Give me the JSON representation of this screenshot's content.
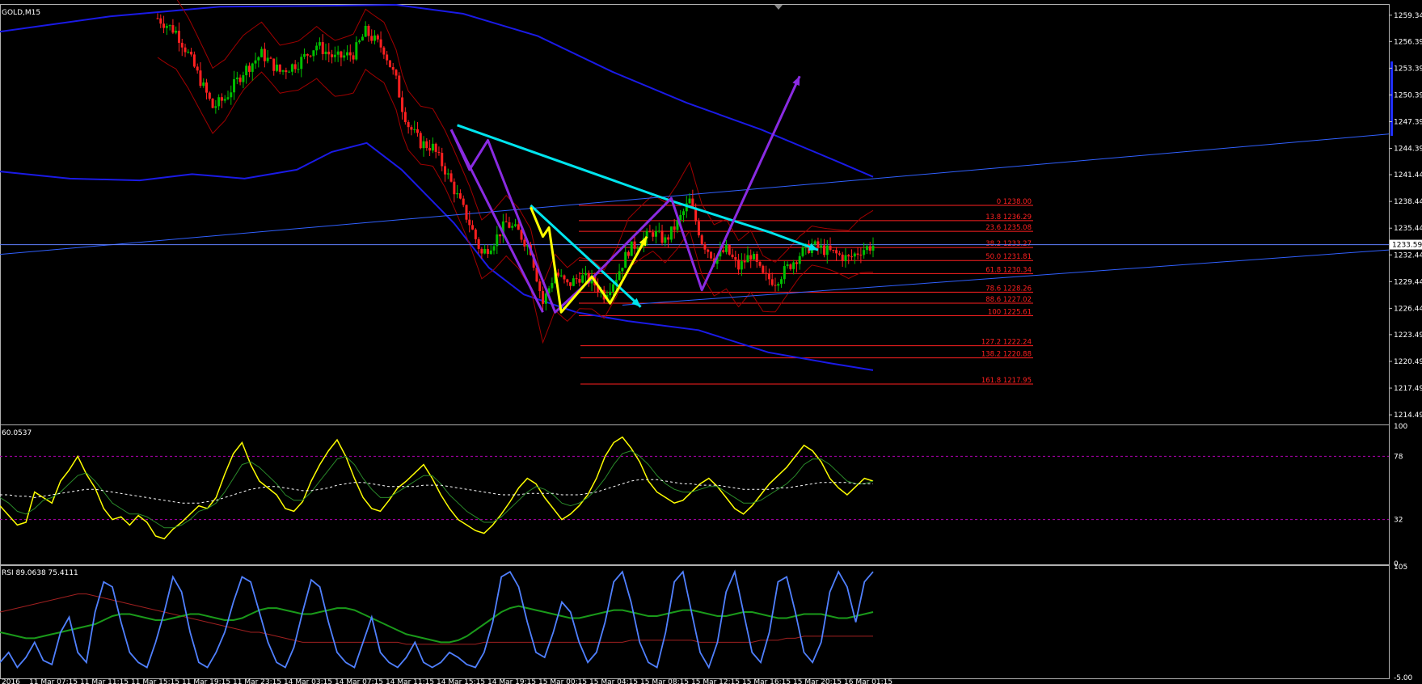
{
  "window": {
    "symbol": "GOLD,M15"
  },
  "colors": {
    "background": "#000000",
    "grid_axis": "#c0c0c0",
    "bull": "#00c000",
    "bear": "#ff2020",
    "ma_blue": "#1a1ae6",
    "bollinger": "#a00000",
    "fib": "#ff2020",
    "cyan": "#00e5ee",
    "purple": "#8a2be2",
    "yellow": "#ffff00",
    "rsi_blue": "#5080ff",
    "dash_magenta": "#b000b0"
  },
  "chart_data": [
    {
      "panel": "main",
      "type": "candlestick",
      "title": "GOLD,M15",
      "ylim": [
        1213.5,
        1260.5
      ],
      "y_ticks": [
        "1259.34",
        "1256.39",
        "1253.39",
        "1250.39",
        "1247.39",
        "1244.39",
        "1241.44",
        "1238.44",
        "1235.44",
        "1232.44",
        "1229.44",
        "1226.44",
        "1223.49",
        "1220.49",
        "1217.49",
        "1214.49"
      ],
      "y_tick_values": [
        1259.34,
        1256.39,
        1253.39,
        1250.39,
        1247.39,
        1244.39,
        1241.44,
        1238.44,
        1235.44,
        1232.44,
        1229.44,
        1226.44,
        1223.49,
        1220.49,
        1217.49,
        1214.49
      ],
      "current_price": "1233.59",
      "close_path": [
        [
          0,
          1259.0
        ],
        [
          3,
          1257.5
        ],
        [
          5,
          1255.0
        ],
        [
          7,
          1252.0
        ],
        [
          9,
          1249.0
        ],
        [
          11,
          1250.0
        ],
        [
          14,
          1253.0
        ],
        [
          17,
          1255.0
        ],
        [
          20,
          1253.0
        ],
        [
          23,
          1254.0
        ],
        [
          26,
          1256.0
        ],
        [
          29,
          1254.5
        ],
        [
          32,
          1255.0
        ],
        [
          34,
          1257.5
        ],
        [
          37,
          1255.5
        ],
        [
          39,
          1252.0
        ],
        [
          40,
          1249.0
        ],
        [
          41,
          1247.0
        ],
        [
          43,
          1245.0
        ],
        [
          45,
          1244.5
        ],
        [
          47,
          1242.0
        ],
        [
          49,
          1239.0
        ],
        [
          51,
          1236.0
        ],
        [
          53,
          1232.5
        ],
        [
          55,
          1234.0
        ],
        [
          57,
          1236.0
        ],
        [
          59,
          1235.0
        ],
        [
          61,
          1233.0
        ],
        [
          63,
          1227.0
        ],
        [
          65,
          1230.5
        ],
        [
          67,
          1229.0
        ],
        [
          69,
          1230.0
        ],
        [
          71,
          1229.5
        ],
        [
          73,
          1228.0
        ],
        [
          75,
          1230.0
        ],
        [
          77,
          1233.0
        ],
        [
          79,
          1234.0
        ],
        [
          81,
          1235.0
        ],
        [
          83,
          1234.0
        ],
        [
          85,
          1236.0
        ],
        [
          87,
          1238.5
        ],
        [
          89,
          1234.0
        ],
        [
          91,
          1232.0
        ],
        [
          93,
          1233.0
        ],
        [
          95,
          1231.0
        ],
        [
          97,
          1232.5
        ],
        [
          99,
          1230.0
        ],
        [
          101,
          1229.5
        ],
        [
          103,
          1231.0
        ],
        [
          105,
          1232.5
        ],
        [
          107,
          1233.5
        ],
        [
          109,
          1233.0
        ],
        [
          111,
          1232.5
        ],
        [
          113,
          1232.0
        ],
        [
          115,
          1233.0
        ],
        [
          117,
          1233.5
        ]
      ],
      "fibonacci": [
        {
          "label": "0 1238.00",
          "price": 1238.0
        },
        {
          "label": "13.8 1236.29",
          "price": 1236.29
        },
        {
          "label": "23.6 1235.08",
          "price": 1235.08
        },
        {
          "label": "38.2 1233.27",
          "price": 1233.27
        },
        {
          "label": "50.0 1231.81",
          "price": 1231.81
        },
        {
          "label": "61.8 1230.34",
          "price": 1230.34
        },
        {
          "label": "78.6 1228.26",
          "price": 1228.26
        },
        {
          "label": "88.6 1227.02",
          "price": 1227.02
        },
        {
          "label": "100 1225.61",
          "price": 1225.61
        },
        {
          "label": "127.2 1222.24",
          "price": 1222.24
        },
        {
          "label": "138.2 1220.88",
          "price": 1220.88
        },
        {
          "label": "161.8 1217.95",
          "price": 1217.95
        }
      ],
      "ma_upper": [
        [
          0,
          1257.5
        ],
        [
          10,
          1259.2
        ],
        [
          20,
          1260.3
        ],
        [
          30,
          1260.4
        ],
        [
          36,
          1260.5
        ],
        [
          45,
          1259.5
        ],
        [
          55,
          1257.0
        ],
        [
          65,
          1253.0
        ],
        [
          75,
          1249.5
        ],
        [
          85,
          1246.5
        ],
        [
          95,
          1243.0
        ],
        [
          100,
          1241.2
        ]
      ],
      "ma_lower": [
        [
          0,
          1241.8
        ],
        [
          8,
          1241.0
        ],
        [
          16,
          1240.8
        ],
        [
          22,
          1241.5
        ],
        [
          28,
          1241.0
        ],
        [
          34,
          1242.0
        ],
        [
          38,
          1244.0
        ],
        [
          42,
          1245.0
        ],
        [
          46,
          1242.0
        ],
        [
          52,
          1236.0
        ],
        [
          56,
          1231.0
        ],
        [
          60,
          1228.0
        ],
        [
          66,
          1226.0
        ],
        [
          72,
          1225.0
        ],
        [
          80,
          1224.0
        ],
        [
          88,
          1221.5
        ],
        [
          95,
          1220.3
        ],
        [
          100,
          1219.5
        ]
      ],
      "drawings": {
        "cyan_trend": [
          [
            49,
            1247.0
          ],
          [
            84,
            1238.5
          ],
          [
            100,
            1235.0
          ],
          [
            108,
            1233.0
          ]
        ],
        "cyan_small": [
          [
            61,
            1238.0
          ],
          [
            79,
            1226.6
          ]
        ],
        "purple_zigzag": [
          [
            48,
            1246.5
          ],
          [
            51,
            1242.0
          ],
          [
            54,
            1245.3
          ],
          [
            65,
            1226.0
          ],
          [
            71,
            1229.8
          ],
          [
            84,
            1238.8
          ],
          [
            89,
            1228.5
          ],
          [
            105,
            1252.5
          ]
        ],
        "purple_early": [
          [
            48,
            1246.5
          ],
          [
            63,
            1226.0
          ]
        ],
        "yellow_zigzag": [
          [
            61,
            1237.8
          ],
          [
            63,
            1234.5
          ],
          [
            64,
            1235.5
          ],
          [
            66,
            1226.0
          ],
          [
            71,
            1230.0
          ],
          [
            74,
            1227.0
          ],
          [
            80,
            1234.5
          ]
        ],
        "blue_channel_upper": [
          [
            0,
            1232.5
          ],
          [
            117,
            1246.0
          ]
        ],
        "blue_channel_lower": [
          [
            76,
            1226.8
          ],
          [
            117,
            1233.0
          ]
        ],
        "h_line": 1233.59
      }
    },
    {
      "panel": "oscillator",
      "type": "line",
      "label": "60.0537",
      "y_ticks": [
        "100",
        "78",
        "32",
        "0"
      ],
      "y_tick_values": [
        100,
        78,
        32,
        0
      ],
      "ylim": [
        0,
        100
      ],
      "levels": [
        78,
        32
      ],
      "series": [
        {
          "values": [
            42,
            35,
            28,
            30,
            52,
            48,
            44,
            60,
            68,
            78,
            65,
            55,
            40,
            32,
            34,
            28,
            35,
            30,
            20,
            18,
            25,
            30,
            36,
            42,
            40,
            48,
            65,
            80,
            88,
            72,
            60,
            55,
            50,
            40,
            38,
            45,
            60,
            72,
            82,
            90,
            78,
            62,
            48,
            40,
            38,
            46,
            55,
            60,
            66,
            72,
            62,
            50,
            40,
            32,
            28,
            24,
            22,
            28,
            36,
            45,
            55,
            62,
            58,
            48,
            40,
            32,
            36,
            42,
            50,
            62,
            78,
            88,
            92,
            84,
            74,
            60,
            52,
            48,
            44,
            46,
            52,
            58,
            62,
            56,
            48,
            40,
            36,
            42,
            50,
            58,
            64,
            70,
            78,
            86,
            82,
            74,
            62,
            55,
            50,
            56,
            62,
            60
          ]
        },
        {
          "values": [
            48,
            44,
            38,
            36,
            40,
            46,
            48,
            52,
            58,
            64,
            66,
            60,
            52,
            44,
            40,
            36,
            36,
            34,
            30,
            26,
            26,
            28,
            32,
            38,
            40,
            44,
            52,
            62,
            72,
            74,
            70,
            64,
            58,
            50,
            46,
            46,
            52,
            60,
            68,
            76,
            78,
            72,
            62,
            54,
            48,
            48,
            52,
            56,
            60,
            64,
            64,
            58,
            50,
            44,
            38,
            34,
            30,
            30,
            34,
            40,
            46,
            52,
            56,
            54,
            50,
            44,
            42,
            44,
            48,
            54,
            62,
            72,
            80,
            82,
            78,
            72,
            64,
            58,
            54,
            52,
            52,
            54,
            56,
            56,
            52,
            48,
            44,
            44,
            46,
            50,
            54,
            58,
            64,
            72,
            76,
            76,
            72,
            66,
            60,
            58,
            58,
            60
          ]
        },
        {
          "values": [
            50,
            50,
            49,
            49,
            48,
            49,
            50,
            51,
            52,
            53,
            54,
            54,
            53,
            52,
            51,
            50,
            49,
            48,
            47,
            46,
            45,
            44,
            44,
            44,
            45,
            46,
            48,
            50,
            52,
            54,
            55,
            56,
            56,
            55,
            54,
            53,
            53,
            54,
            55,
            57,
            58,
            59,
            59,
            58,
            57,
            56,
            56,
            56,
            56,
            57,
            57,
            57,
            56,
            55,
            54,
            53,
            52,
            51,
            50,
            50,
            50,
            51,
            51,
            51,
            51,
            50,
            50,
            50,
            51,
            52,
            54,
            56,
            58,
            60,
            61,
            61,
            61,
            60,
            59,
            58,
            58,
            57,
            57,
            57,
            56,
            55,
            54,
            54,
            54,
            54,
            55,
            55,
            56,
            57,
            58,
            59,
            59,
            59,
            59,
            58,
            58,
            58
          ]
        }
      ]
    },
    {
      "panel": "rsi",
      "type": "line",
      "label": "RSI 89.0638 75.4111",
      "y_ticks": [
        "105",
        "-5.00"
      ],
      "y_tick_values": [
        105,
        -5
      ],
      "ylim": [
        -5,
        105
      ],
      "series": [
        {
          "values": [
            10,
            20,
            5,
            15,
            30,
            12,
            8,
            40,
            55,
            20,
            10,
            60,
            90,
            85,
            50,
            20,
            10,
            5,
            30,
            60,
            95,
            80,
            40,
            10,
            5,
            20,
            40,
            70,
            95,
            90,
            60,
            30,
            10,
            5,
            25,
            60,
            92,
            85,
            50,
            20,
            10,
            5,
            30,
            55,
            20,
            10,
            5,
            15,
            30,
            10,
            5,
            10,
            20,
            15,
            8,
            5,
            20,
            50,
            95,
            100,
            85,
            50,
            20,
            15,
            40,
            70,
            60,
            30,
            10,
            20,
            50,
            90,
            100,
            70,
            30,
            10,
            5,
            40,
            90,
            100,
            60,
            20,
            5,
            30,
            80,
            100,
            60,
            20,
            10,
            40,
            90,
            95,
            60,
            20,
            10,
            30,
            80,
            100,
            85,
            50,
            90,
            100
          ]
        },
        {
          "values": [
            40,
            38,
            36,
            34,
            34,
            36,
            38,
            40,
            42,
            44,
            46,
            48,
            52,
            56,
            58,
            58,
            56,
            54,
            52,
            52,
            54,
            56,
            58,
            58,
            56,
            54,
            52,
            52,
            54,
            58,
            62,
            64,
            64,
            62,
            60,
            58,
            58,
            60,
            62,
            64,
            64,
            62,
            58,
            54,
            50,
            46,
            42,
            38,
            36,
            34,
            32,
            30,
            30,
            32,
            36,
            42,
            48,
            54,
            60,
            64,
            66,
            64,
            62,
            60,
            58,
            56,
            54,
            54,
            56,
            58,
            60,
            62,
            62,
            60,
            58,
            56,
            56,
            58,
            60,
            62,
            62,
            60,
            58,
            56,
            56,
            58,
            60,
            60,
            58,
            56,
            54,
            54,
            56,
            58,
            58,
            58,
            56,
            54,
            54,
            56,
            58,
            60
          ]
        },
        {
          "values": [
            60,
            62,
            64,
            66,
            68,
            70,
            72,
            74,
            76,
            78,
            78,
            76,
            74,
            72,
            70,
            68,
            66,
            64,
            62,
            60,
            58,
            56,
            54,
            52,
            50,
            48,
            46,
            44,
            42,
            40,
            40,
            38,
            36,
            34,
            32,
            30,
            30,
            30,
            30,
            30,
            30,
            30,
            30,
            30,
            30,
            30,
            30,
            28,
            28,
            28,
            28,
            28,
            28,
            28,
            28,
            28,
            30,
            30,
            30,
            30,
            30,
            30,
            30,
            30,
            30,
            30,
            30,
            30,
            30,
            30,
            30,
            30,
            30,
            32,
            32,
            32,
            32,
            32,
            32,
            32,
            32,
            30,
            30,
            30,
            30,
            30,
            30,
            30,
            32,
            32,
            32,
            34,
            34,
            36,
            36,
            36,
            36,
            36,
            36,
            36,
            36,
            36
          ]
        }
      ]
    }
  ],
  "x_axis_labels": [
    "2016",
    "11 Mar 07:15",
    "11 Mar 11:15",
    "11 Mar 15:15",
    "11 Mar 19:15",
    "11 Mar 23:15",
    "14 Mar 03:15",
    "14 Mar 07:15",
    "14 Mar 11:15",
    "14 Mar 15:15",
    "14 Mar 19:15",
    "15 Mar 00:15",
    "15 Mar 04:15",
    "15 Mar 08:15",
    "15 Mar 12:15",
    "15 Mar 16:15",
    "15 Mar 20:15",
    "16 Mar 01:15"
  ]
}
